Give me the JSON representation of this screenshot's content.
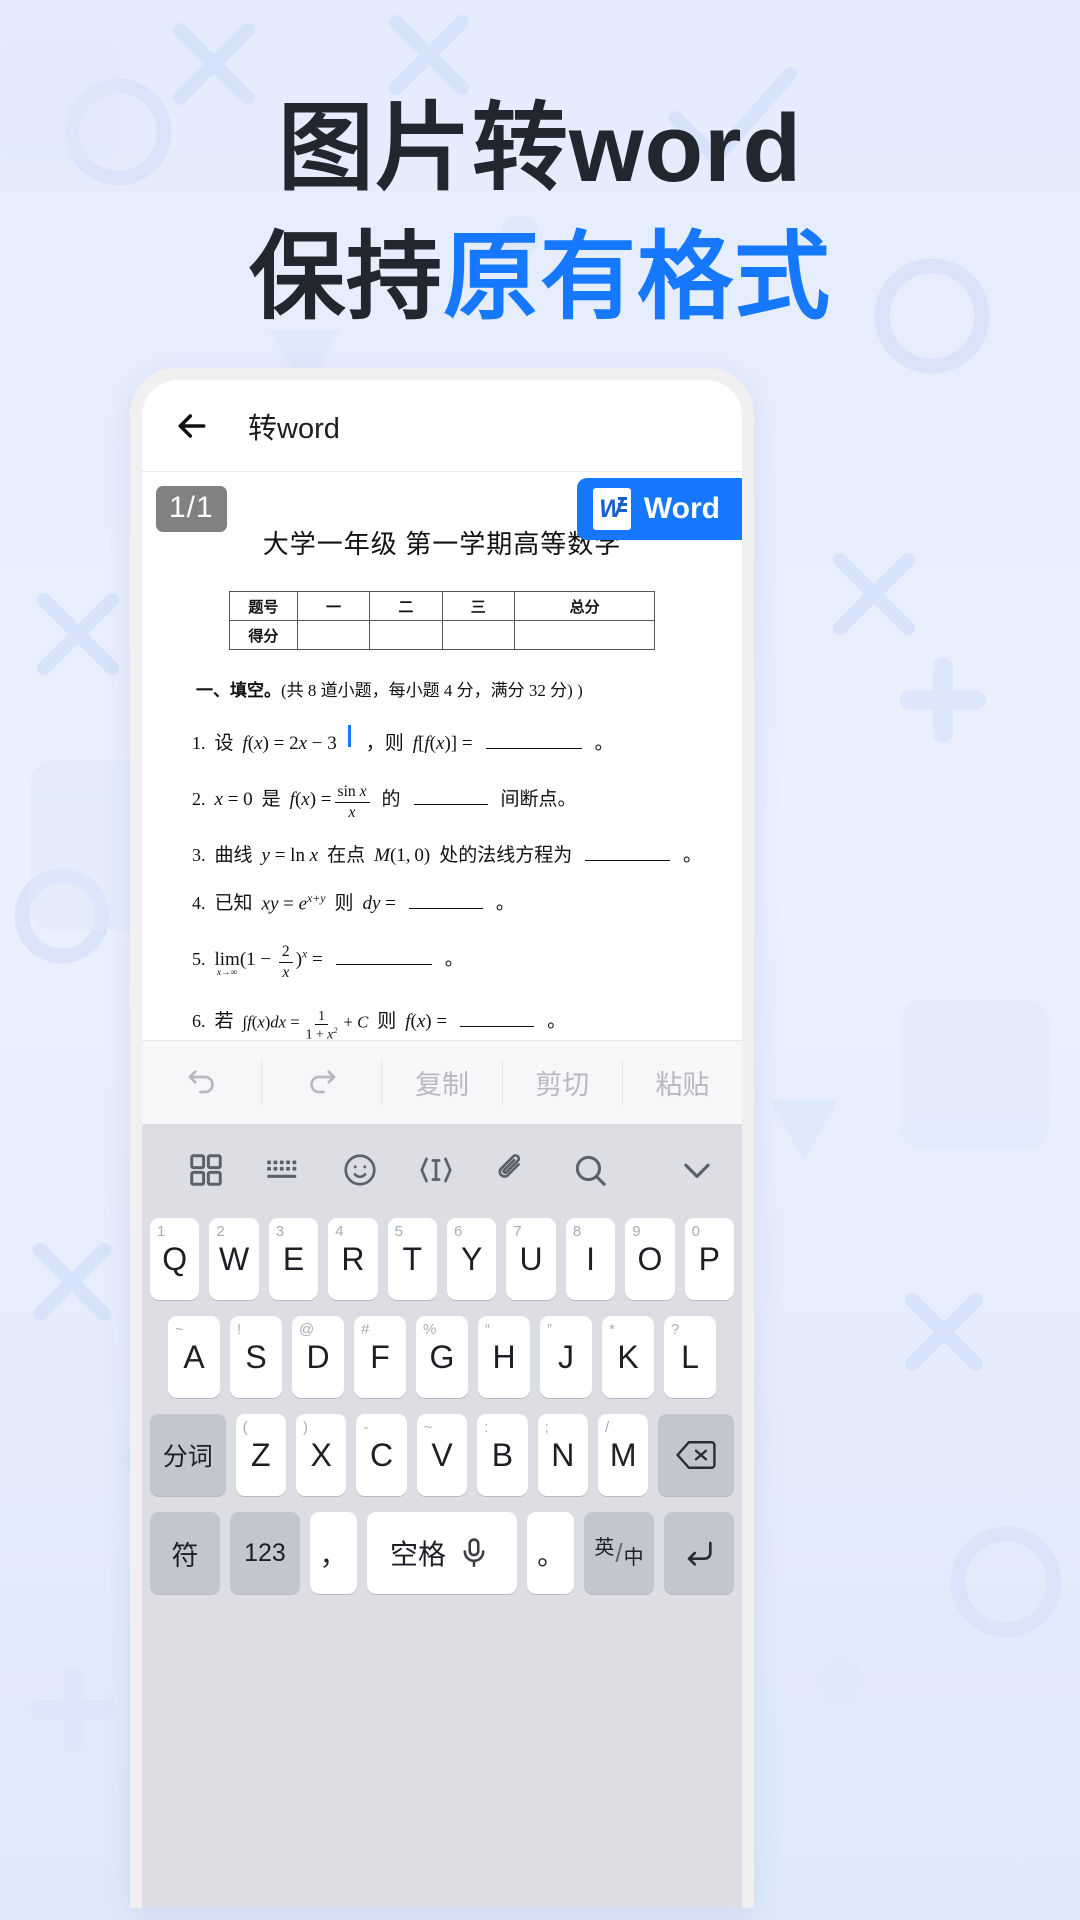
{
  "poster": {
    "headline_line1_part1": "图片转",
    "headline_line1_part2": "word",
    "headline_line2_dark": "保持",
    "headline_line2_accent": "原有格式",
    "accent_color": "#1677ff",
    "dark_color": "#22262e",
    "background_color": "#e8eefc"
  },
  "appbar": {
    "back_icon": "back-arrow-icon",
    "title": "转word"
  },
  "viewer": {
    "page_indicator": "1/1",
    "word_button_label": "Word",
    "word_button_icon": "word-logo-icon",
    "word_button_color": "#1677ff"
  },
  "document": {
    "title": "大学一年级 第一学期高等数学",
    "table": {
      "rows": [
        {
          "header": "题号",
          "cells": [
            "一",
            "二",
            "三",
            "总分"
          ]
        },
        {
          "header": "得分",
          "cells": [
            "",
            "",
            "",
            ""
          ]
        }
      ]
    },
    "section_heading_bold": "一、填空。",
    "section_heading_rest": "(共 8 道小题，每小题 4 分，满分 32 分) )",
    "questions": [
      {
        "num": "1.",
        "plain": "设  f(x) = 2x − 3  ，则  f[f(x)] = ________ 。",
        "lead": "设",
        "tail_cn": "，则",
        "end": "。"
      },
      {
        "num": "2.",
        "plain": "x = 0 是  f(x) = sin x / x  的 ________ 间断点。",
        "lead": "是",
        "tail_cn": "的",
        "after_blank": "间断点。"
      },
      {
        "num": "3.",
        "plain": "曲线 y = ln x  在点 M(1,0) 处的法线方程为 ________ 。",
        "lead": "曲线",
        "mid": "在点",
        "tail_cn": "处的法线方程为",
        "end": "。"
      },
      {
        "num": "4.",
        "plain": "已知 xy = e^(x+y) 则 dy = ________ 。",
        "lead": "已知",
        "tail_cn": "则",
        "end": "。"
      },
      {
        "num": "5.",
        "plain": "lim(x→∞) (1 − 2/x)^x = ________ 。",
        "end": "。"
      },
      {
        "num": "6.",
        "plain": "若 ∫f(x)dx = 1/(1+x²) + C 则 f(x) = ________ 。",
        "lead": "若",
        "tail_cn": "则",
        "end": "。"
      }
    ]
  },
  "edit_toolbar": {
    "items": [
      {
        "name": "undo-icon",
        "label": "",
        "icon": "undo"
      },
      {
        "name": "redo-icon",
        "label": "",
        "icon": "redo"
      },
      {
        "name": "copy",
        "label": "复制",
        "icon": ""
      },
      {
        "name": "cut",
        "label": "剪切",
        "icon": ""
      },
      {
        "name": "paste",
        "label": "粘贴",
        "icon": ""
      }
    ]
  },
  "keyboard": {
    "tools": [
      "grid-icon",
      "keyboard-icon",
      "emoji-icon",
      "text-cursor-icon",
      "clipboard-icon",
      "search-icon",
      "chevron-down-icon"
    ],
    "row1": [
      {
        "hint": "1",
        "label": "Q"
      },
      {
        "hint": "2",
        "label": "W"
      },
      {
        "hint": "3",
        "label": "E"
      },
      {
        "hint": "4",
        "label": "R"
      },
      {
        "hint": "5",
        "label": "T"
      },
      {
        "hint": "6",
        "label": "Y"
      },
      {
        "hint": "7",
        "label": "U"
      },
      {
        "hint": "8",
        "label": "I"
      },
      {
        "hint": "9",
        "label": "O"
      },
      {
        "hint": "0",
        "label": "P"
      }
    ],
    "row2": [
      {
        "hint": "~",
        "label": "A"
      },
      {
        "hint": "!",
        "label": "S"
      },
      {
        "hint": "@",
        "label": "D"
      },
      {
        "hint": "#",
        "label": "F"
      },
      {
        "hint": "%",
        "label": "G"
      },
      {
        "hint": "“",
        "label": "H"
      },
      {
        "hint": "”",
        "label": "J"
      },
      {
        "hint": "*",
        "label": "K"
      },
      {
        "hint": "?",
        "label": "L"
      }
    ],
    "row3_left": "分词",
    "row3": [
      {
        "hint": "(",
        "label": "Z"
      },
      {
        "hint": ")",
        "label": "X"
      },
      {
        "hint": "-",
        "label": "C"
      },
      {
        "hint": "~",
        "label": "V"
      },
      {
        "hint": ":",
        "label": "B"
      },
      {
        "hint": ";",
        "label": "N"
      },
      {
        "hint": "/",
        "label": "M"
      }
    ],
    "row3_right": "backspace-icon",
    "row4": [
      {
        "label": "符",
        "name": "symbol-key"
      },
      {
        "label": "123",
        "name": "numeric-key"
      },
      {
        "label": "，",
        "name": "comma-key"
      },
      {
        "label": "空格",
        "name": "space-key",
        "icon": "mic-icon"
      },
      {
        "label": "。",
        "name": "period-key"
      },
      {
        "label_top": "英",
        "label_bottom": "中",
        "name": "language-toggle-key"
      },
      {
        "label": "",
        "name": "enter-key",
        "icon": "enter-icon"
      }
    ]
  }
}
